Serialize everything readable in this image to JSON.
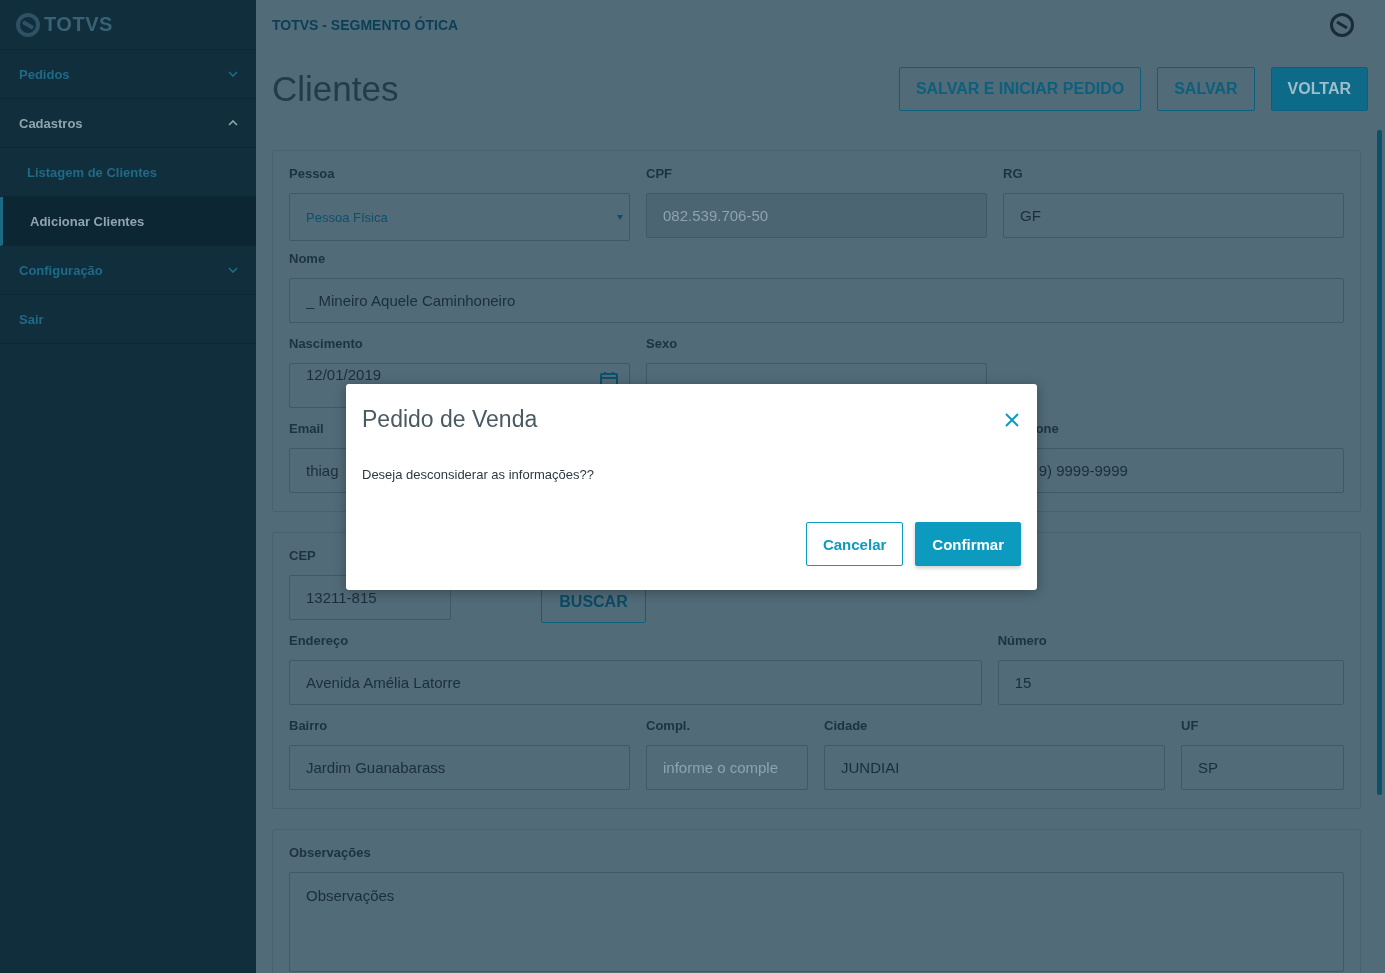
{
  "sidebar": {
    "logo": "TOTVS",
    "items": [
      {
        "label": "Pedidos",
        "kind": "group",
        "expanded": false
      },
      {
        "label": "Cadastros",
        "kind": "group",
        "expanded": true,
        "children": [
          {
            "label": "Listagem de Clientes",
            "selected": false
          },
          {
            "label": "Adicionar Clientes",
            "selected": true
          }
        ]
      },
      {
        "label": "Configuração",
        "kind": "group",
        "expanded": false
      },
      {
        "label": "Sair",
        "kind": "link"
      }
    ]
  },
  "header": {
    "breadcrumb": "TOTVS - SEGMENTO ÓTICA"
  },
  "page": {
    "title": "Clientes",
    "actions": [
      {
        "label": "SALVAR E INICIAR PEDIDO",
        "kind": "outline"
      },
      {
        "label": "SALVAR",
        "kind": "outline"
      },
      {
        "label": "VOLTAR",
        "kind": "primary"
      }
    ]
  },
  "panels": [
    {
      "rows": [
        {
          "fields": [
            {
              "label": "Pessoa",
              "kind": "select",
              "value": "Pessoa Física"
            },
            {
              "label": "CPF",
              "kind": "disabled",
              "value": "082.539.706-50"
            },
            {
              "label": "RG",
              "kind": "text",
              "value": "GF"
            }
          ]
        },
        {
          "fields": [
            {
              "label": "Nome",
              "kind": "text",
              "value": "_ Mineiro Aquele Caminhoneiro"
            }
          ]
        },
        {
          "fields": [
            {
              "label": "Nascimento",
              "kind": "date",
              "value": "12/01/2019"
            },
            {
              "label": "Sexo",
              "kind": "text"
            }
          ]
        },
        {
          "fields": [
            {
              "label": "Email",
              "kind": "text",
              "value": "thiag"
            },
            {
              "label": "one",
              "kind": "text",
              "value": "9) 9999-9999",
              "cut_left": true
            }
          ]
        }
      ]
    },
    {
      "rows": [
        {
          "fields": [
            {
              "label": "CEP",
              "kind": "text",
              "value": "13211-815"
            },
            {
              "kind": "spacer"
            },
            {
              "kind": "button",
              "value": "BUSCAR"
            }
          ]
        },
        {
          "fields": [
            {
              "label": "Endereço",
              "kind": "text",
              "value": "Avenida Amélia Latorre"
            },
            {
              "label": "Número",
              "kind": "text",
              "value": "15"
            }
          ]
        },
        {
          "fields": [
            {
              "label": "Bairro",
              "kind": "text",
              "value": "Jardim Guanabarass"
            },
            {
              "label": "Compl.",
              "kind": "text",
              "placeholder": "informe o comple"
            },
            {
              "label": "Cidade",
              "kind": "text",
              "value": "JUNDIAI"
            },
            {
              "label": "UF",
              "kind": "text",
              "value": "SP"
            }
          ]
        }
      ]
    },
    {
      "rows": [
        {
          "fields": [
            {
              "label": "Observações",
              "kind": "textarea",
              "value": "Observações"
            }
          ]
        }
      ]
    }
  ],
  "dialog": {
    "title": "Pedido de Venda",
    "message": "Deseja desconsiderar as informações??",
    "buttons": [
      {
        "label": "Cancelar",
        "kind": "outline"
      },
      {
        "label": "Confirmar",
        "kind": "primary"
      }
    ]
  }
}
